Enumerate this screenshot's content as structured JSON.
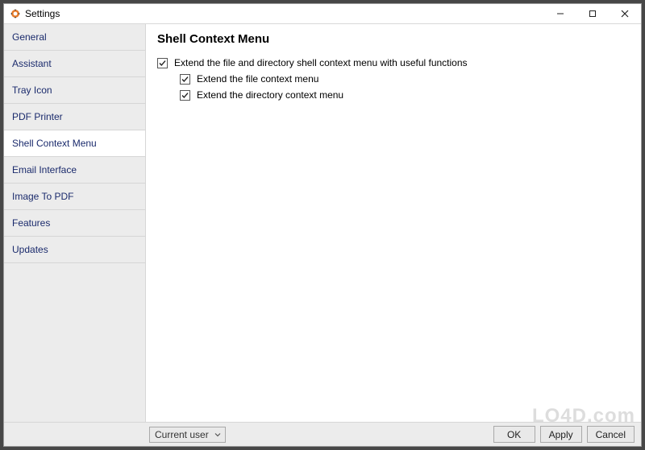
{
  "window": {
    "title": "Settings"
  },
  "sidebar": {
    "items": [
      {
        "label": "General"
      },
      {
        "label": "Assistant"
      },
      {
        "label": "Tray Icon"
      },
      {
        "label": "PDF Printer"
      },
      {
        "label": "Shell Context Menu"
      },
      {
        "label": "Email Interface"
      },
      {
        "label": "Image To PDF"
      },
      {
        "label": "Features"
      },
      {
        "label": "Updates"
      }
    ],
    "selected_index": 4
  },
  "content": {
    "heading": "Shell Context Menu",
    "options": {
      "master": {
        "label": "Extend the file and directory shell context menu with useful functions",
        "checked": true
      },
      "child1": {
        "label": "Extend the file context menu",
        "checked": true
      },
      "child2": {
        "label": "Extend the directory context menu",
        "checked": true
      }
    }
  },
  "footer": {
    "scope_selected": "Current user",
    "buttons": {
      "ok": "OK",
      "apply": "Apply",
      "cancel": "Cancel"
    }
  },
  "watermark": "LO4D.com"
}
